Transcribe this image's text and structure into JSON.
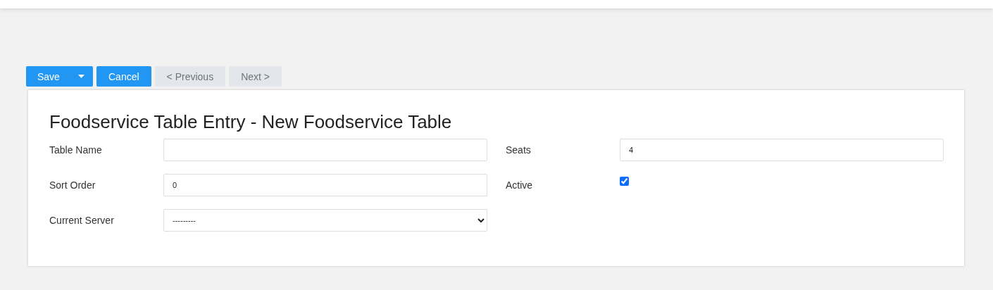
{
  "toolbar": {
    "buttons": [
      {
        "label": "Save",
        "kind": "split",
        "disabled": false
      },
      {
        "label": "Cancel",
        "kind": "plain",
        "disabled": false
      },
      {
        "label": "< Previous",
        "kind": "plain",
        "disabled": true
      },
      {
        "label": "Next >",
        "kind": "plain",
        "disabled": true
      }
    ]
  },
  "form": {
    "title": "Foodservice Table Entry - New Foodservice Table",
    "rows": [
      [
        {
          "label": "Table Name",
          "kind": "text"
        },
        {
          "label": "Seats",
          "kind": "text",
          "value": "4"
        }
      ],
      [
        {
          "label": "Sort Order",
          "kind": "text",
          "value": "0"
        },
        {
          "label": "Active",
          "kind": "checkbox",
          "checked": true
        }
      ],
      [
        {
          "label": "Current Server",
          "kind": "select",
          "value": "---------"
        }
      ]
    ]
  }
}
